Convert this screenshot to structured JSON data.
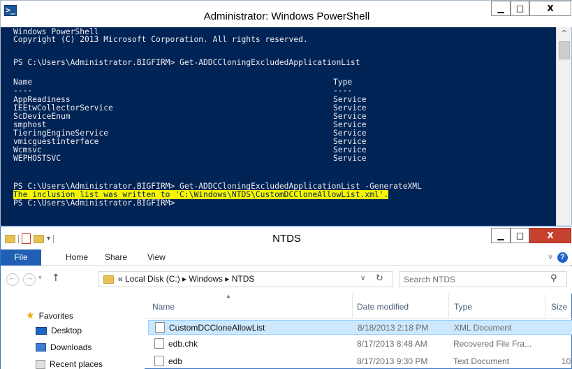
{
  "powershell": {
    "title": "Administrator: Windows PowerShell",
    "app_icon": "powershell-icon",
    "lines": [
      "Windows PowerShell",
      "Copyright (C) 2013 Microsoft Corporation. All rights reserved.",
      "PS C:\\Users\\Administrator.BIGFIRM> Get-ADDCCloningExcludedApplicationList",
      "Name",
      "----",
      "PS C:\\Users\\Administrator.BIGFIRM> Get-ADDCCloningExcludedApplicationList -GenerateXML",
      "The inclusion list was written to 'C:\\Windows\\NTDS\\CustomDCCloneAllowList.xml'.",
      "PS C:\\Users\\Administrator.BIGFIRM>"
    ],
    "type_header": "Type",
    "type_divider": "----",
    "apps": [
      {
        "name": "AppReadiness",
        "type": "Service"
      },
      {
        "name": "IEEtwCollectorService",
        "type": "Service"
      },
      {
        "name": "ScDeviceEnum",
        "type": "Service"
      },
      {
        "name": "smphost",
        "type": "Service"
      },
      {
        "name": "TieringEngineService",
        "type": "Service"
      },
      {
        "name": "vmicguestinterface",
        "type": "Service"
      },
      {
        "name": "Wcmsvc",
        "type": "Service"
      },
      {
        "name": "WEPHOSTSVC",
        "type": "Service"
      }
    ],
    "colors": {
      "background": "#012456",
      "foreground": "#eeedf0",
      "highlight": "#f6f600"
    }
  },
  "explorer": {
    "title": "NTDS",
    "ribbon": {
      "file": "File",
      "home": "Home",
      "share": "Share",
      "view": "View"
    },
    "address": "« Local Disk (C:)  ▸  Windows  ▸  NTDS",
    "search_placeholder": "Search NTDS",
    "favorites_label": "Favorites",
    "nav_items": [
      "Desktop",
      "Downloads",
      "Recent places"
    ],
    "columns": {
      "name": "Name",
      "date": "Date modified",
      "type": "Type",
      "size": "Size"
    },
    "files": [
      {
        "name": "CustomDCCloneAllowList",
        "date": "8/18/2013 2:18 PM",
        "type": "XML Document",
        "size": ""
      },
      {
        "name": "edb.chk",
        "date": "8/17/2013 8:48 AM",
        "type": "Recovered File Fra...",
        "size": ""
      },
      {
        "name": "edb",
        "date": "8/17/2013 9:30 PM",
        "type": "Text Document",
        "size": "10"
      }
    ],
    "colors": {
      "accent": "#1f5fb4",
      "selection": "#cce8ff",
      "close": "#c7412f"
    }
  }
}
